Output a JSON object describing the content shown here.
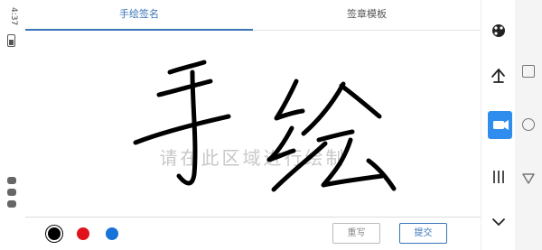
{
  "status": {
    "time": "4:37"
  },
  "tabs": [
    {
      "label": "手绘签名",
      "active": true
    },
    {
      "label": "签章模板",
      "active": false
    }
  ],
  "canvas": {
    "watermark": "请在此区域进行绘制",
    "ink_color": "#000000"
  },
  "palette": [
    {
      "name": "black",
      "color": "#000000",
      "selected": true
    },
    {
      "name": "red",
      "color": "#e0121b",
      "selected": false
    },
    {
      "name": "blue",
      "color": "#1572d6",
      "selected": false
    }
  ],
  "buttons": {
    "rewrite_label": "重写",
    "submit_label": "提交"
  },
  "toolbar": {
    "items": [
      "palette-icon",
      "refresh-hand-icon",
      "camera-icon",
      "lines-icon",
      "chevron-down-icon"
    ],
    "active": "camera-icon",
    "accent": "#2f8dee"
  },
  "colors": {
    "accent": "#3a74b8"
  }
}
